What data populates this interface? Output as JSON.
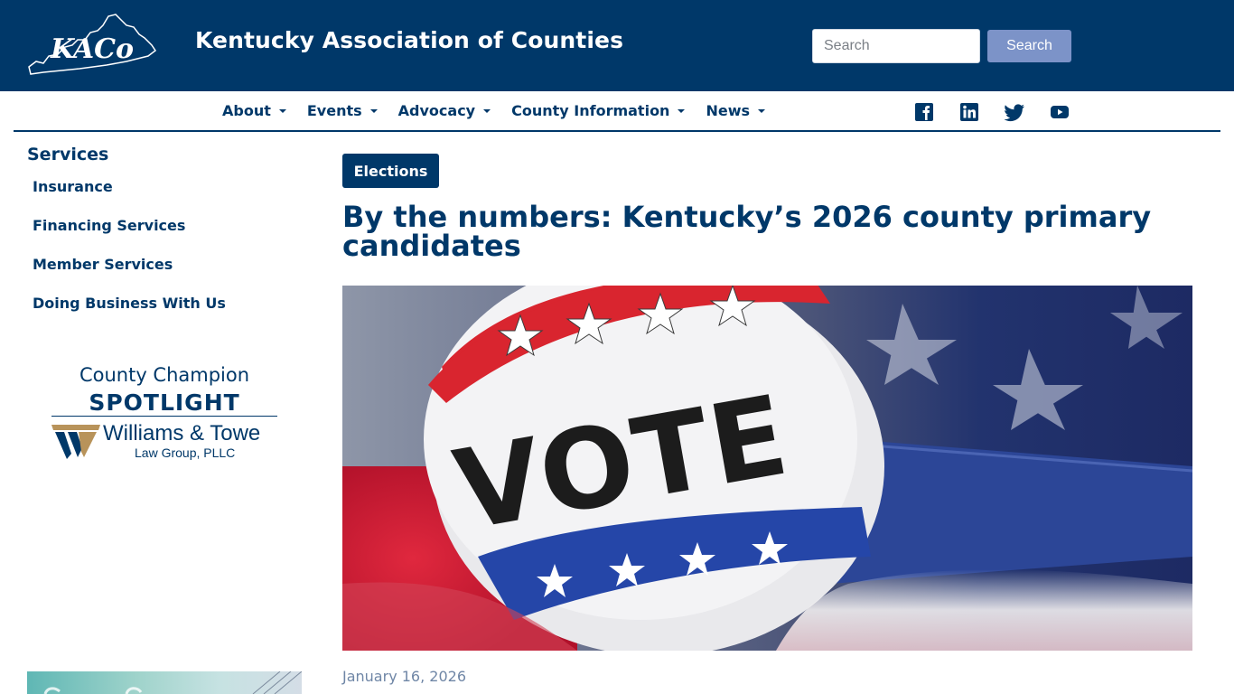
{
  "header": {
    "logo_text": "KACo",
    "site_title": "Kentucky Association of Counties",
    "search": {
      "placeholder": "Search",
      "button_label": "Search"
    }
  },
  "nav": {
    "items": [
      {
        "label": "About"
      },
      {
        "label": "Events"
      },
      {
        "label": "Advocacy"
      },
      {
        "label": "County Information"
      },
      {
        "label": "News"
      }
    ],
    "social_icons": [
      "facebook-icon",
      "linkedin-icon",
      "twitter-icon",
      "youtube-icon"
    ]
  },
  "sidebar": {
    "heading": "Services",
    "links": [
      "Insurance",
      "Financing Services",
      "Member Services",
      "Doing Business With Us"
    ],
    "champion": {
      "line1": "County Champion",
      "line2": "SPOTLIGHT",
      "sponsor_name": "Williams & Towe",
      "sponsor_sub": "Law Group, PLLC"
    }
  },
  "article": {
    "category": "Elections",
    "title": "By the numbers: Kentucky’s 2026 county primary candidates",
    "hero_text": "VOTE",
    "date": "January 16, 2026"
  },
  "colors": {
    "brand_navy": "#003869",
    "search_button": "#7c93c8",
    "date_text": "#6f86a6"
  }
}
